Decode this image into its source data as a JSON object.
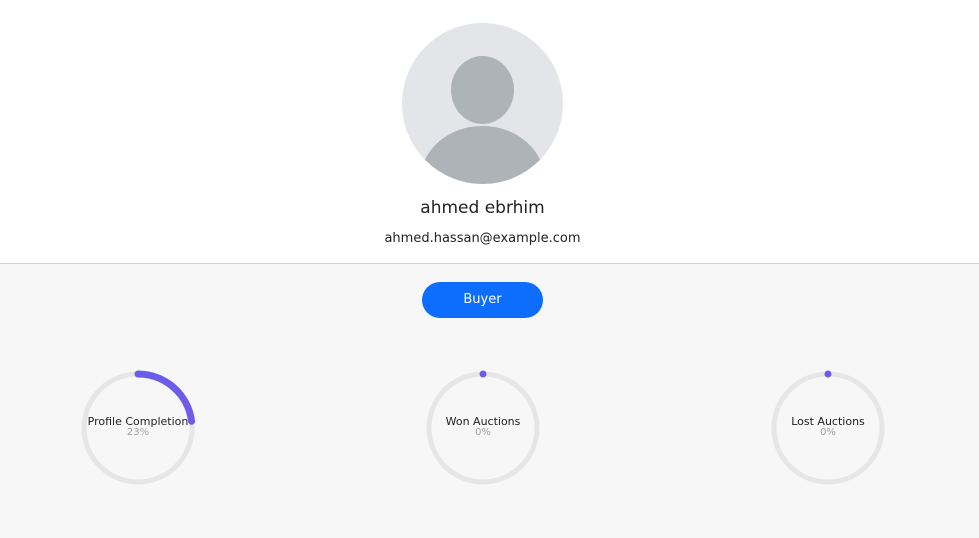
{
  "profile": {
    "name": "ahmed ebrhim",
    "email": "ahmed.hassan@example.com"
  },
  "role": {
    "label": "Buyer"
  },
  "colors": {
    "accent": "#6c5ce7",
    "track": "#e6e6e6",
    "button": "#0d6efd"
  },
  "stats": [
    {
      "label": "Profile Completion",
      "value_text": "23%",
      "fraction": 0.23
    },
    {
      "label": "Won Auctions",
      "value_text": "0%",
      "fraction": 0
    },
    {
      "label": "Lost Auctions",
      "value_text": "0%",
      "fraction": 0
    }
  ]
}
